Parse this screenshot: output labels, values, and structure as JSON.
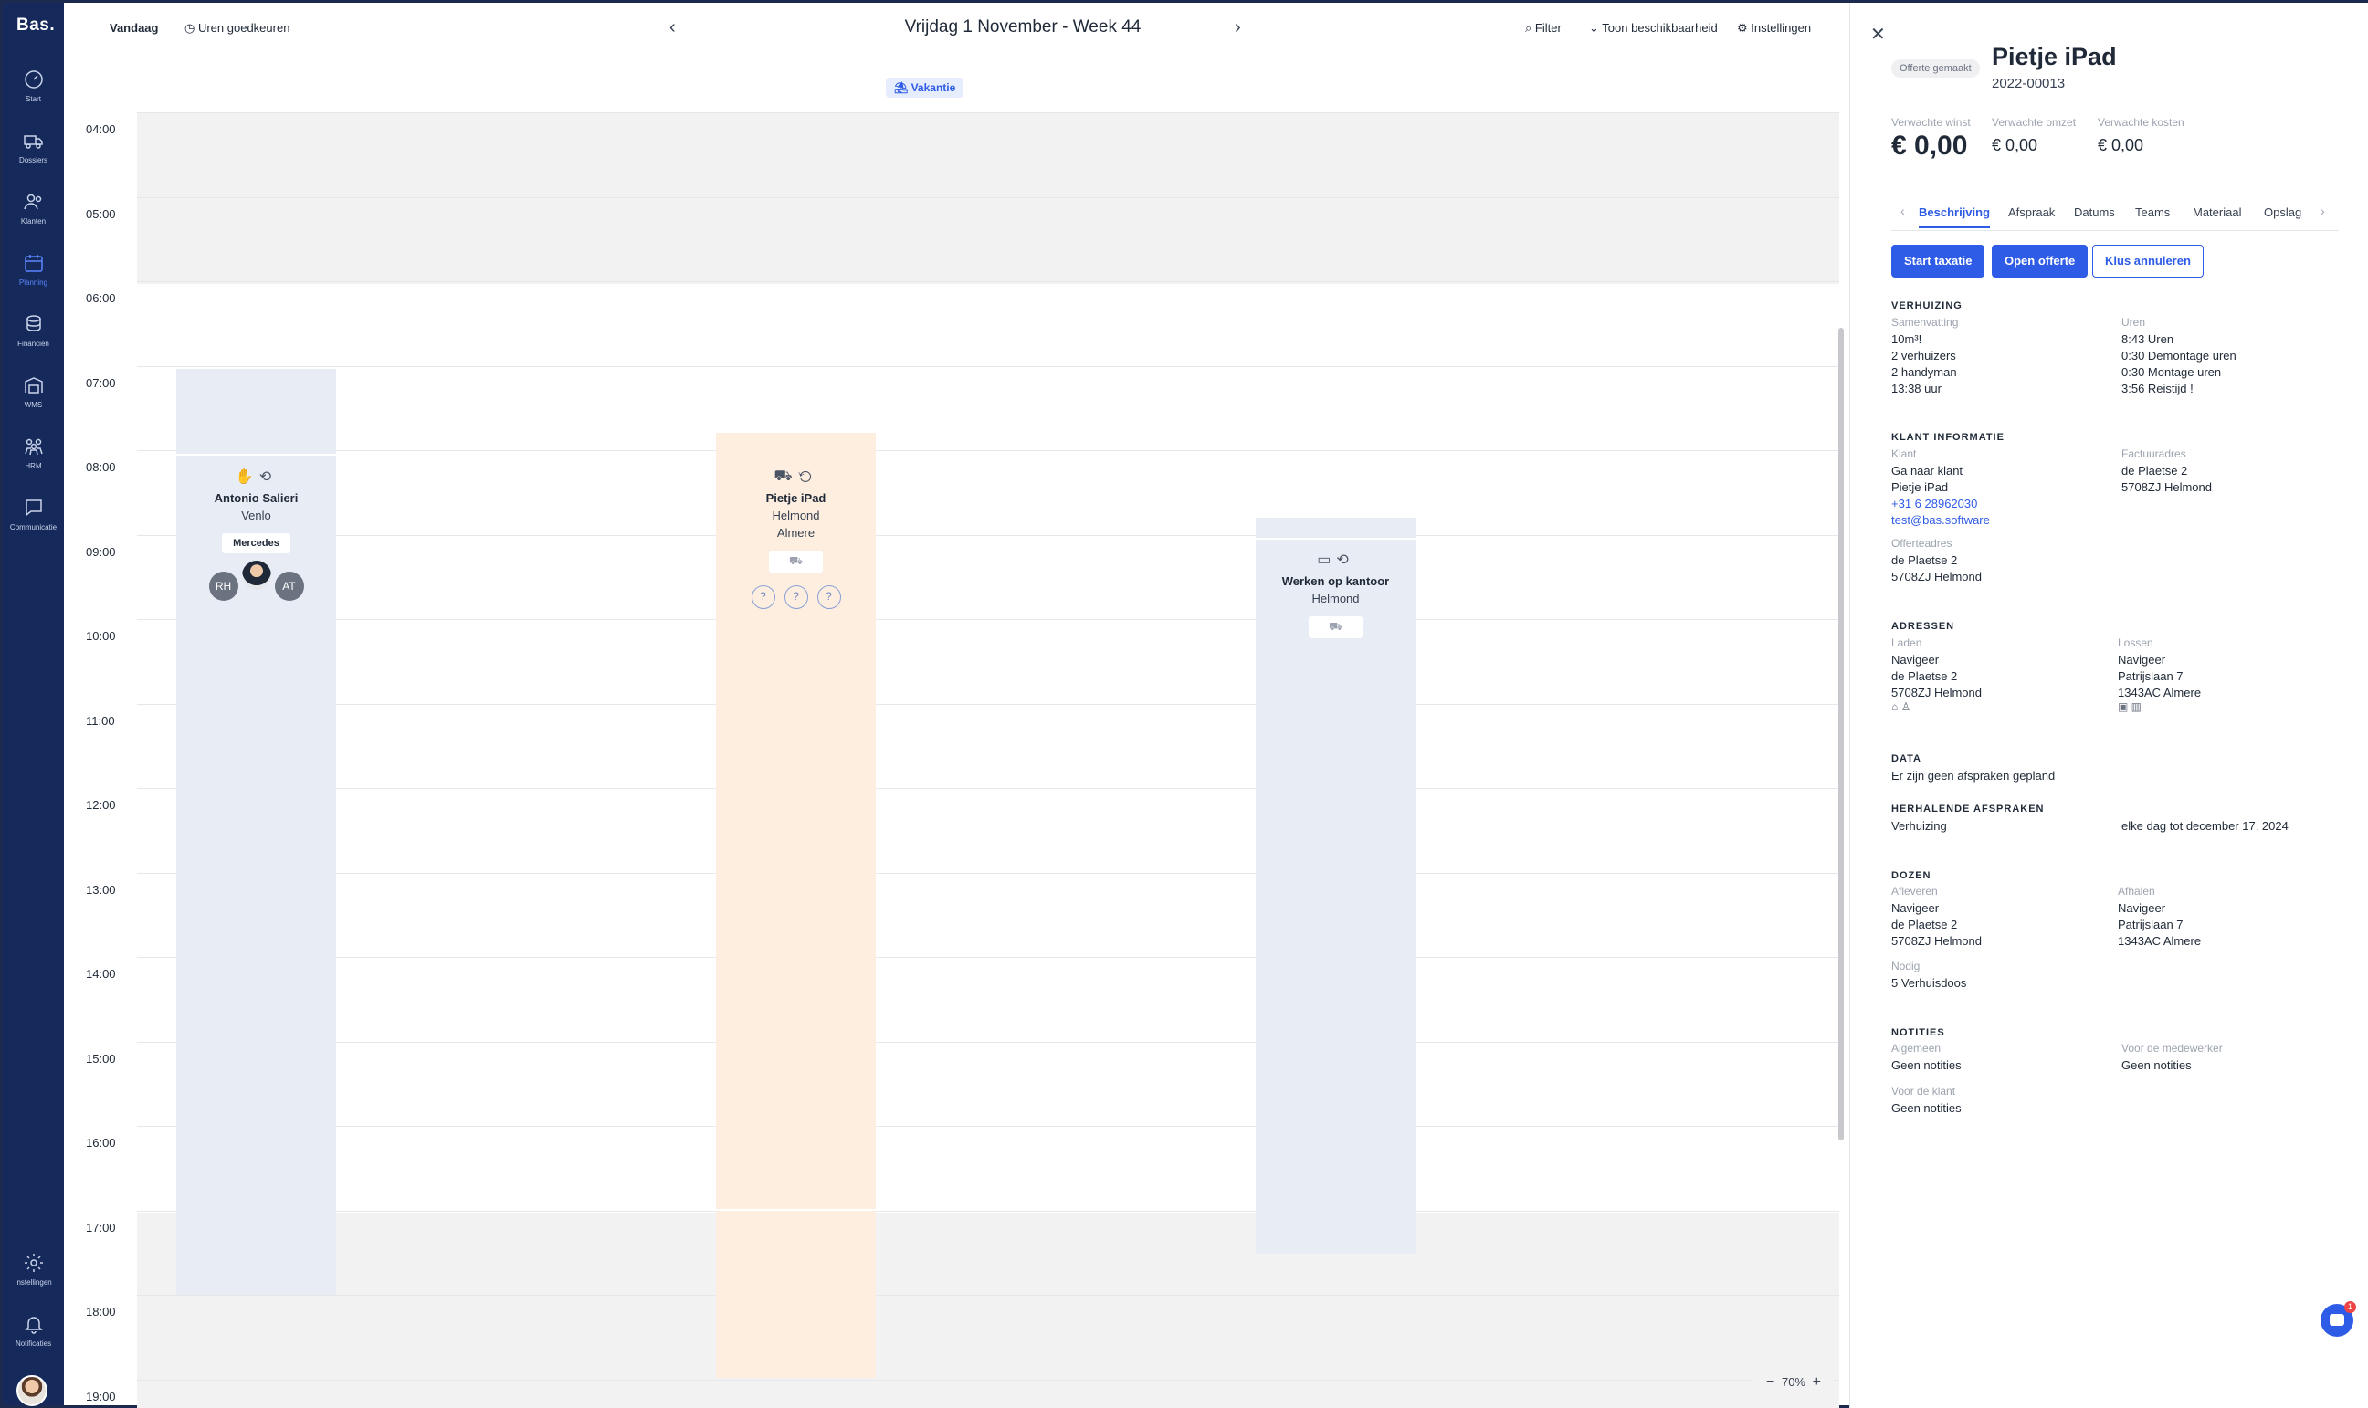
{
  "app": {
    "logo": "Bas."
  },
  "sidebar": {
    "items": [
      {
        "label": "Start",
        "icon": "gauge-icon"
      },
      {
        "label": "Dossiers",
        "icon": "truck-icon"
      },
      {
        "label": "Klanten",
        "icon": "users-icon"
      },
      {
        "label": "Planning",
        "icon": "calendar-icon"
      },
      {
        "label": "Financiën",
        "icon": "coins-icon"
      },
      {
        "label": "WMS",
        "icon": "warehouse-icon"
      },
      {
        "label": "HRM",
        "icon": "team-icon"
      },
      {
        "label": "Communicatie",
        "icon": "chat-icon"
      }
    ],
    "bottom": [
      {
        "label": "Instellingen",
        "icon": "gear-icon"
      },
      {
        "label": "Notificaties",
        "icon": "bell-icon"
      }
    ]
  },
  "topbar": {
    "today": "Vandaag",
    "approve": "Uren goedkeuren",
    "title": "Vrijdag 1 November - Week 44",
    "filter": "Filter",
    "availability": "Toon beschikbaarheid",
    "settings": "Instellingen"
  },
  "calendar": {
    "vacation_label": "Vakantie",
    "hours": [
      "04:00",
      "05:00",
      "06:00",
      "07:00",
      "08:00",
      "09:00",
      "10:00",
      "11:00",
      "12:00",
      "13:00",
      "14:00",
      "15:00",
      "16:00",
      "17:00",
      "18:00",
      "19:00"
    ],
    "zoom": "70%",
    "events": [
      {
        "title": "Antonio Salieri",
        "sub1": "Venlo",
        "tag": "Mercedes",
        "people": [
          "RH",
          "",
          "AT"
        ]
      },
      {
        "title": "Pietje iPad",
        "sub1": "Helmond",
        "sub2": "Almere"
      },
      {
        "title": "Werken op kantoor",
        "sub1": "Helmond"
      }
    ]
  },
  "panel": {
    "status": "Offerte gemaakt",
    "title": "Pietje iPad",
    "code": "2022-00013",
    "kpis": [
      {
        "label": "Verwachte winst",
        "value": "€ 0,00"
      },
      {
        "label": "Verwachte omzet",
        "value": "€ 0,00"
      },
      {
        "label": "Verwachte kosten",
        "value": "€ 0,00"
      }
    ],
    "tabs": [
      "Beschrijving",
      "Afspraak",
      "Datums",
      "Teams",
      "Materiaal",
      "Opslag"
    ],
    "buttons": {
      "start": "Start taxatie",
      "open": "Open offerte",
      "cancel": "Klus annuleren"
    },
    "verhuizing": {
      "title": "VERHUIZING",
      "summary_label": "Samenvatting",
      "summary": [
        "10m³!",
        "2 verhuizers",
        "2 handyman",
        "13:38 uur"
      ],
      "hours_label": "Uren",
      "hours": [
        "8:43 Uren",
        "0:30 Demontage uren",
        "0:30 Montage uren",
        "3:56 Reistijd !"
      ]
    },
    "klant": {
      "title": "KLANT INFORMATIE",
      "client_label": "Klant",
      "goto": "Ga naar klant",
      "name": "Pietje iPad",
      "phone": "+31 6 28962030",
      "email": "test@bas.software",
      "invoice_label": "Factuuradres",
      "invoice": [
        "de Plaetse 2",
        "5708ZJ Helmond"
      ],
      "quote_label": "Offerteadres",
      "quote": [
        "de Plaetse 2",
        "5708ZJ Helmond"
      ]
    },
    "adressen": {
      "title": "ADRESSEN",
      "load_label": "Laden",
      "load": [
        "Navigeer",
        "de Plaetse 2",
        "5708ZJ Helmond"
      ],
      "unload_label": "Lossen",
      "unload": [
        "Navigeer",
        "Patrijslaan 7",
        "1343AC Almere"
      ]
    },
    "data": {
      "title": "DATA",
      "text": "Er zijn geen afspraken gepland"
    },
    "herhalend": {
      "title": "HERHALENDE AFSPRAKEN",
      "name": "Verhuizing",
      "rule": "elke dag tot december 17, 2024"
    },
    "dozen": {
      "title": "DOZEN",
      "deliver_label": "Afleveren",
      "deliver": [
        "Navigeer",
        "de Plaetse 2",
        "5708ZJ Helmond"
      ],
      "pickup_label": "Afhalen",
      "pickup": [
        "Navigeer",
        "Patrijslaan 7",
        "1343AC Almere"
      ],
      "needed_label": "Nodig",
      "needed": "5 Verhuisdoos"
    },
    "notities": {
      "title": "NOTITIES",
      "general_label": "Algemeen",
      "general": "Geen notities",
      "employee_label": "Voor de medewerker",
      "employee": "Geen notities",
      "client_label": "Voor de klant",
      "client": "Geen notities"
    },
    "chat_badge": "1"
  },
  "colors": {
    "sidebar": "#15295b",
    "accent": "#2f5ce6",
    "event_blue": "#e8ecf5",
    "event_orange": "#fdeee0"
  }
}
